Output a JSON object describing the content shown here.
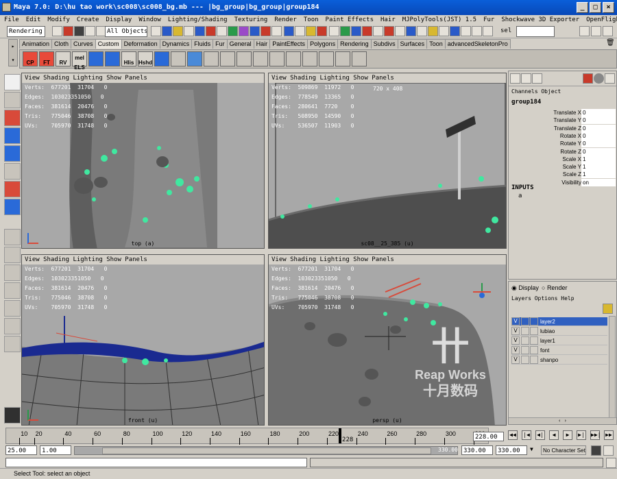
{
  "window": {
    "title": "Maya 7.0: D:\\hu tao work\\sc008\\sc008_bg.mb   ---   |bg_group|bg_group|group184",
    "min": "_",
    "max": "□",
    "close": "×"
  },
  "menu": [
    "File",
    "Edit",
    "Modify",
    "Create",
    "Display",
    "Window",
    "Lighting/Shading",
    "Texturing",
    "Render",
    "Toon",
    "Paint Effects",
    "Hair",
    "MJPolyTools(JST) 1.5",
    "Fur",
    "Shockwave 3D Exporter",
    "OpenFlight",
    "Help"
  ],
  "status": {
    "menuset": "Rendering",
    "selection_mode": "All Objects",
    "sel_label": "sel"
  },
  "shelf_tabs": [
    "Animation",
    "Cloth",
    "Curves",
    "Custom",
    "Deformation",
    "Dynamics",
    "Fluids",
    "Fur",
    "General",
    "Hair",
    "PaintEffects",
    "Polygons",
    "Rendering",
    "Subdivs",
    "Surfaces",
    "Toon",
    "advancedSkeletonPro"
  ],
  "shelf_active": "Custom",
  "shelf_buttons": [
    "CP",
    "FT",
    "RV",
    "ELS",
    "mel",
    "Hlis",
    "Hshd"
  ],
  "viewport_menu": "View Shading Lighting Show Panels",
  "viewports": [
    {
      "name": "top",
      "camera": "top (a)",
      "stats": "Verts:  677201  31704   0\nEdges:  103023351050   0\nFaces:  381614  20476   0\nTris:   775046  38708   0\nUVs:    705970  31748   0"
    },
    {
      "name": "cam",
      "camera": "sc08__25_385 (u)",
      "resolution": "720 x 408",
      "stats": "Verts:  509869  11972   0\nEdges:  778549  13365   0\nFaces:  280641  7720    0\nTris:   508950  14590   0\nUVs:    536507  11903   0"
    },
    {
      "name": "front",
      "camera": "front (u)",
      "stats": "Verts:  677201  31704   0\nEdges:  103023351050   0\nFaces:  381614  20476   0\nTris:   775046  38708   0\nUVs:    705970  31748   0"
    },
    {
      "name": "persp",
      "camera": "persp (u)",
      "stats": "Verts:  677201  31704   0\nEdges:  103023351050   0\nFaces:  381614  20476   0\nTris:   775046  38708   0\nUVs:    705970  31748   0"
    }
  ],
  "watermark": {
    "line1": "Reap Works",
    "line2": "十月数码"
  },
  "channel_box": {
    "menu": "Channels  Object",
    "object": "group184",
    "channels": [
      {
        "name": "Translate X",
        "value": "0"
      },
      {
        "name": "Translate Y",
        "value": "0"
      },
      {
        "name": "Translate Z",
        "value": "0"
      },
      {
        "name": "Rotate X",
        "value": "0"
      },
      {
        "name": "Rotate Y",
        "value": "0"
      },
      {
        "name": "Rotate Z",
        "value": "0"
      },
      {
        "name": "Scale X",
        "value": "1"
      },
      {
        "name": "Scale Y",
        "value": "1"
      },
      {
        "name": "Scale Z",
        "value": "1"
      },
      {
        "name": "Visibility",
        "value": "on"
      }
    ],
    "inputs_label": "INPUTS",
    "inputs_item": "a"
  },
  "layer_editor": {
    "display": "Display",
    "render": "Render",
    "menu": "Layers  Options  Help",
    "layers": [
      {
        "v": "V",
        "name": "layer2",
        "selected": true
      },
      {
        "v": "V",
        "name": "lubiao",
        "selected": false
      },
      {
        "v": "V",
        "name": "layer1",
        "selected": false
      },
      {
        "v": "V",
        "name": "font",
        "selected": false
      },
      {
        "v": "V",
        "name": "shanpo",
        "selected": false
      }
    ]
  },
  "timeline": {
    "ticks": [
      "10",
      "20",
      "40",
      "60",
      "80",
      "100",
      "120",
      "140",
      "160",
      "180",
      "200",
      "220",
      "240",
      "260",
      "280",
      "300",
      "320"
    ],
    "current_frame": "228",
    "current_field": "228.00",
    "play_buttons": [
      "|◀",
      "◀|",
      "◀",
      "▶",
      "▶|",
      "▶▶|",
      "◀◀"
    ]
  },
  "range": {
    "start": "25.00",
    "playback_start": "1.00",
    "slider_end_label": "330.00",
    "end": "330.00",
    "anim_end": "330.00",
    "character_set": "No Character Set"
  },
  "help_line": "Select Tool: select an object",
  "colors": {
    "title_bar": "#0a5fd9",
    "viewport_bg": "#a8a8a8",
    "selection": "#3060c0",
    "plant_green": "#40e8a0"
  }
}
